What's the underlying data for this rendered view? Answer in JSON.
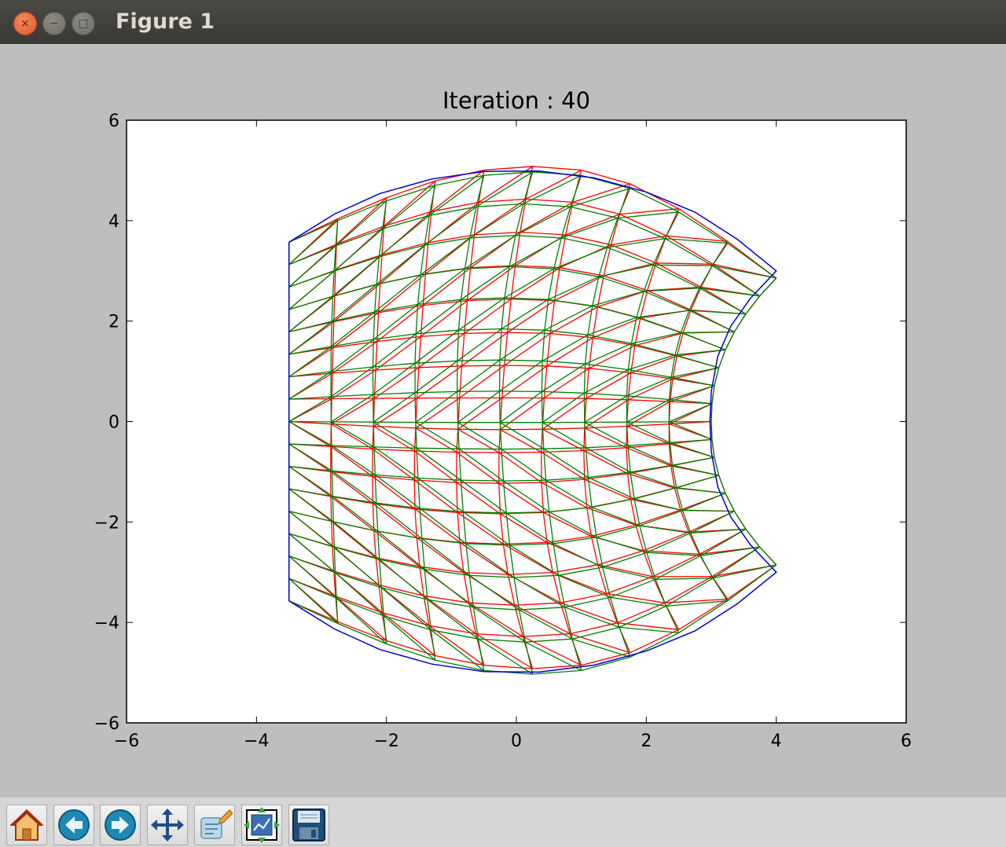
{
  "window": {
    "title": "Figure 1"
  },
  "titlebar_buttons": {
    "close": "×",
    "minimize": "−",
    "maximize": "□"
  },
  "toolbar": {
    "buttons": [
      {
        "name": "home",
        "icon": "home-icon"
      },
      {
        "name": "back",
        "icon": "back-arrow-icon"
      },
      {
        "name": "forward",
        "icon": "forward-arrow-icon"
      },
      {
        "name": "pan",
        "icon": "move-arrows-icon"
      },
      {
        "name": "zoom",
        "icon": "zoom-rect-icon"
      },
      {
        "name": "configure-subplots",
        "icon": "subplots-icon"
      },
      {
        "name": "save",
        "icon": "floppy-disk-icon"
      }
    ]
  },
  "chart_data": {
    "type": "line",
    "title": "Iteration : 40",
    "xlabel": "",
    "ylabel": "",
    "xlim": [
      -6,
      6
    ],
    "ylim": [
      -6,
      6
    ],
    "xticks": [
      -6,
      -4,
      -2,
      0,
      2,
      4,
      6
    ],
    "yticks": [
      -6,
      -4,
      -2,
      0,
      2,
      4,
      6
    ],
    "xtick_labels": [
      "−6",
      "−4",
      "−2",
      "0",
      "2",
      "4",
      "6"
    ],
    "ytick_labels": [
      "−6",
      "−4",
      "−2",
      "0",
      "2",
      "4",
      "6"
    ],
    "grid": false,
    "series": [
      {
        "color": "#0000cc",
        "style": "boundary",
        "points": [
          [
            -3.5,
            3.57
          ],
          [
            -2.8,
            4.13
          ],
          [
            -2.1,
            4.54
          ],
          [
            -1.3,
            4.83
          ],
          [
            -0.5,
            4.98
          ],
          [
            0.35,
            4.99
          ],
          [
            1.2,
            4.85
          ],
          [
            2.0,
            4.57
          ],
          [
            2.75,
            4.17
          ],
          [
            3.4,
            3.63
          ],
          [
            4.0,
            3.0
          ],
          [
            3.6,
            2.45
          ],
          [
            3.3,
            1.9
          ],
          [
            3.1,
            1.3
          ],
          [
            3.0,
            0.6
          ],
          [
            2.98,
            0.0
          ],
          [
            3.0,
            -0.6
          ],
          [
            3.1,
            -1.3
          ],
          [
            3.3,
            -1.9
          ],
          [
            3.6,
            -2.45
          ],
          [
            4.0,
            -3.0
          ],
          [
            3.4,
            -3.63
          ],
          [
            2.75,
            -4.17
          ],
          [
            2.0,
            -4.57
          ],
          [
            1.2,
            -4.85
          ],
          [
            0.35,
            -4.99
          ],
          [
            -0.5,
            -4.98
          ],
          [
            -1.3,
            -4.83
          ],
          [
            -2.1,
            -4.54
          ],
          [
            -2.8,
            -4.13
          ],
          [
            -3.5,
            -3.57
          ],
          [
            -3.5,
            3.57
          ]
        ]
      },
      {
        "name": "",
        "color": "#ff0000",
        "style": "mesh"
      },
      {
        "name": "",
        "color": "#007f00",
        "style": "mesh"
      }
    ]
  }
}
